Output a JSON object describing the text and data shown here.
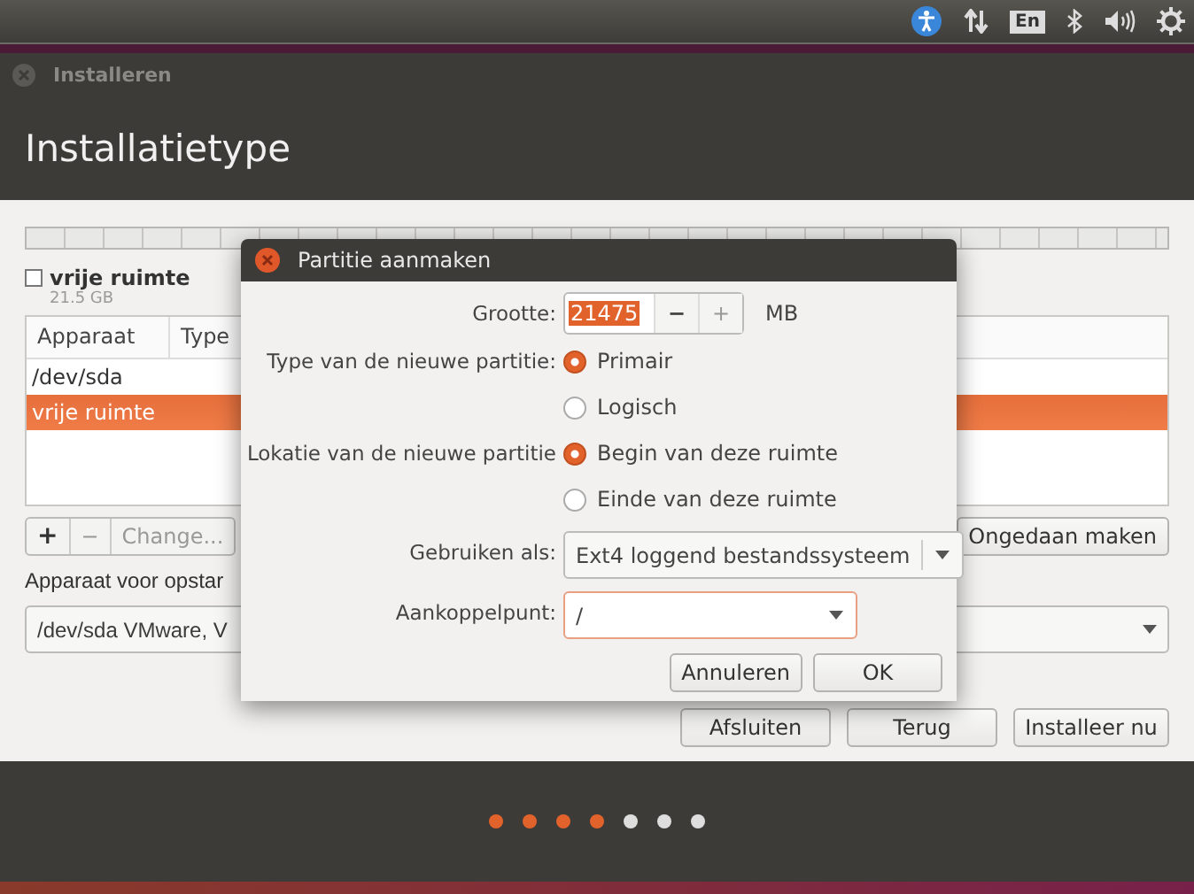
{
  "top_panel": {
    "keyboard_layout": "En"
  },
  "window": {
    "title": "Installeren",
    "heading": "Installatietype"
  },
  "partition_legend": {
    "name": "vrije ruimte",
    "size": "21.5 GB"
  },
  "table": {
    "columns": [
      "Apparaat",
      "Type"
    ],
    "rows": [
      {
        "device": "/dev/sda",
        "selected": false
      },
      {
        "device": "vrije ruimte",
        "selected": true
      }
    ]
  },
  "table_buttons": {
    "add": "+",
    "remove": "−",
    "change": "Change...",
    "undo": "Ongedaan maken"
  },
  "boot_loader": {
    "label": "Apparaat voor opstar",
    "value": "/dev/sda  VMware, V"
  },
  "buttons": [
    "Afsluiten",
    "Terug",
    "Installeer nu"
  ],
  "progress_steps": [
    {
      "done": true
    },
    {
      "done": true
    },
    {
      "done": true
    },
    {
      "done": true
    },
    {
      "done": false
    },
    {
      "done": false
    },
    {
      "done": false
    }
  ],
  "dialog": {
    "title": "Partitie aanmaken",
    "size_label": "Grootte:",
    "size_value": "21475",
    "size_minus": "−",
    "size_plus": "+",
    "size_unit": "MB",
    "type_label": "Type van de nieuwe partitie:",
    "type_options": [
      {
        "label": "Primair",
        "selected": true
      },
      {
        "label": "Logisch",
        "selected": false
      }
    ],
    "location_label": "Lokatie van de nieuwe partitie",
    "location_options": [
      {
        "label": "Begin van deze ruimte",
        "selected": true
      },
      {
        "label": "Einde van deze ruimte",
        "selected": false
      }
    ],
    "use_as_label": "Gebruiken als:",
    "use_as_value": "Ext4 loggend bestandssysteem",
    "mount_label": "Aankoppelpunt:",
    "mount_value": "/",
    "buttons": [
      "Annuleren",
      "OK"
    ]
  }
}
